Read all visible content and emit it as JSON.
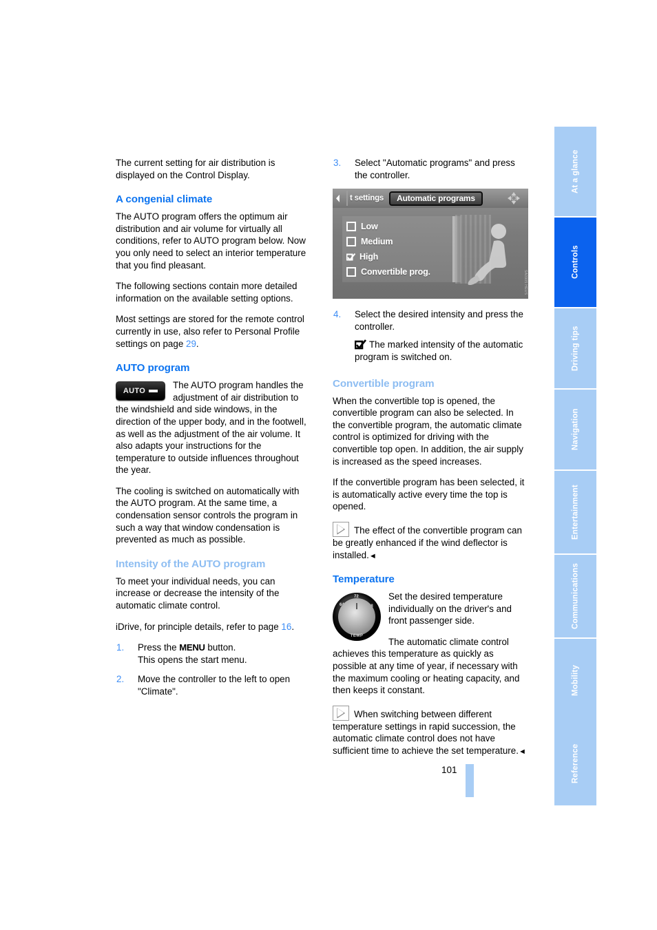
{
  "document": {
    "page_number": "101"
  },
  "side_tabs": [
    {
      "label": "At a glance",
      "active": false
    },
    {
      "label": "Controls",
      "active": true
    },
    {
      "label": "Driving tips",
      "active": false
    },
    {
      "label": "Navigation",
      "active": false
    },
    {
      "label": "Entertainment",
      "active": false
    },
    {
      "label": "Communications",
      "active": false
    },
    {
      "label": "Mobility",
      "active": false
    },
    {
      "label": "Reference",
      "active": false
    }
  ],
  "colors": {
    "heading_blue": "#0d74f0",
    "subheading_blue": "#8dbdf2",
    "tab_inactive": "#a8cdf5",
    "tab_active": "#0b62ee",
    "link_blue": "#3d8df5"
  },
  "left_column": {
    "intro": "The current setting for air distribution is displayed on the Control Display.",
    "congenial": {
      "heading": "A congenial climate",
      "p1": "The AUTO program offers the optimum air distribution and air volume for virtually all conditions, refer to AUTO program below. Now you only need to select an interior temperature that you find pleasant.",
      "p2": "The following sections contain more detailed information on the available setting options.",
      "p3_before": "Most settings are stored for the remote control currently in use, also refer to Personal Profile settings on page ",
      "p3_ref": "29",
      "p3_after": "."
    },
    "auto_program": {
      "heading": "AUTO program",
      "button_label": "AUTO",
      "p1": "The AUTO program handles the adjustment of air distribution to the windshield and side windows, in the direction of the upper body, and in the footwell, as well as the adjustment of the air volume. It also adapts your instructions for the temperature to outside influences throughout the year.",
      "p2": "The cooling is switched on automatically with the AUTO program. At the same time, a condensation sensor controls the program in such a way that window condensation is prevented as much as possible."
    },
    "intensity": {
      "heading": "Intensity of the AUTO program",
      "p1": "To meet your individual needs, you can increase or decrease the intensity of the automatic climate control.",
      "p2_before": "iDrive, for principle details, refer to page ",
      "p2_ref": "16",
      "p2_after": ".",
      "steps": [
        {
          "num": "1.",
          "text_before": "Press the ",
          "kbd": "MENU",
          "text_after": " button.",
          "text_line2": "This opens the start menu."
        },
        {
          "num": "2.",
          "text_before": "Move the controller to the left to open \"Climate\".",
          "kbd": "",
          "text_after": "",
          "text_line2": ""
        }
      ]
    }
  },
  "right_column": {
    "step3": {
      "num": "3.",
      "text": "Select \"Automatic programs\" and press the controller."
    },
    "idrive_screen": {
      "breadcrumb": "t settings",
      "selected_tab": "Automatic programs",
      "nav_icon": "four-way-controller-icon",
      "back_icon": "back-arrow-icon",
      "options": [
        {
          "label": "Low",
          "checked": false
        },
        {
          "label": "Medium",
          "checked": false
        },
        {
          "label": "High",
          "checked": true
        },
        {
          "label": "Convertible prog.",
          "checked": false
        }
      ],
      "watermark": "SA0905 HEUS"
    },
    "step4": {
      "num": "4.",
      "text": "Select the desired intensity and press the controller.",
      "note": "The marked intensity of the automatic program is switched on."
    },
    "convertible": {
      "heading": "Convertible program",
      "p1": "When the convertible top is opened, the convertible program can also be selected. In the convertible program, the automatic climate control is optimized for driving with the convertible top open. In addition, the air supply is increased as the speed increases.",
      "p2": "If the convertible program has been selected, it is automatically active every time the top is opened.",
      "note": "The effect of the convertible program can be greatly enhanced if the wind deflector is installed.",
      "note_end": "◄"
    },
    "temperature": {
      "heading": "Temperature",
      "knob_label": "TEMP",
      "knob_ticks": [
        "64",
        "72",
        "78"
      ],
      "p1": "Set the desired temperature individually on the driver's and front passenger side.",
      "p2": "The automatic climate control achieves this temperature as quickly as possible at any time of year, if necessary with the maximum cooling or heating capacity, and then keeps it constant.",
      "note": "When switching between different temperature settings in rapid succession, the automatic climate control does not have sufficient time to achieve the set temperature.",
      "note_end": "◄"
    }
  }
}
